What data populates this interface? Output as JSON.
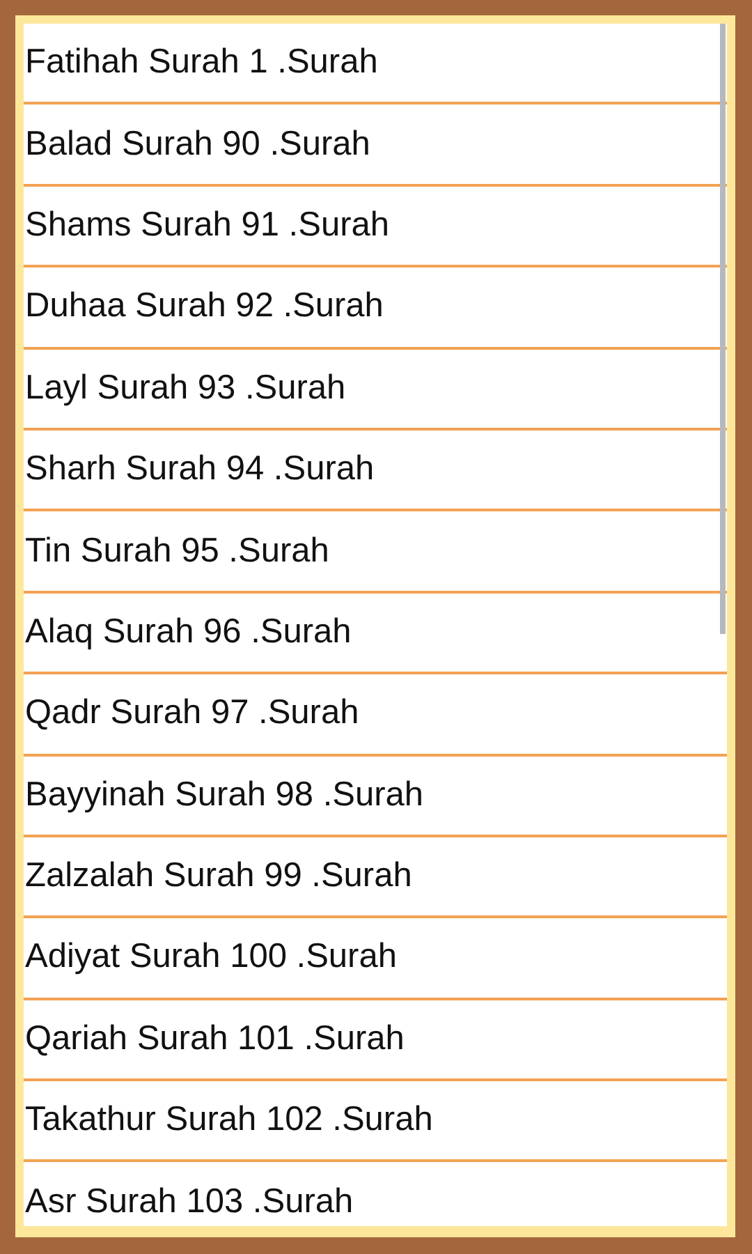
{
  "surahs": [
    {
      "label": "Fatihah Surah 1 .Surah"
    },
    {
      "label": "Balad Surah 90 .Surah"
    },
    {
      "label": "Shams Surah 91 .Surah"
    },
    {
      "label": "Duhaa Surah 92 .Surah"
    },
    {
      "label": "Layl Surah 93 .Surah"
    },
    {
      "label": "Sharh Surah 94 .Surah"
    },
    {
      "label": "Tin Surah 95 .Surah"
    },
    {
      "label": "Alaq Surah 96 .Surah"
    },
    {
      "label": "Qadr Surah 97 .Surah"
    },
    {
      "label": "Bayyinah Surah 98 .Surah"
    },
    {
      "label": "Zalzalah Surah 99 .Surah"
    },
    {
      "label": "Adiyat Surah 100 .Surah"
    },
    {
      "label": "Qariah Surah 101 .Surah"
    },
    {
      "label": "Takathur Surah 102 .Surah"
    },
    {
      "label": "Asr Surah 103 .Surah"
    }
  ]
}
